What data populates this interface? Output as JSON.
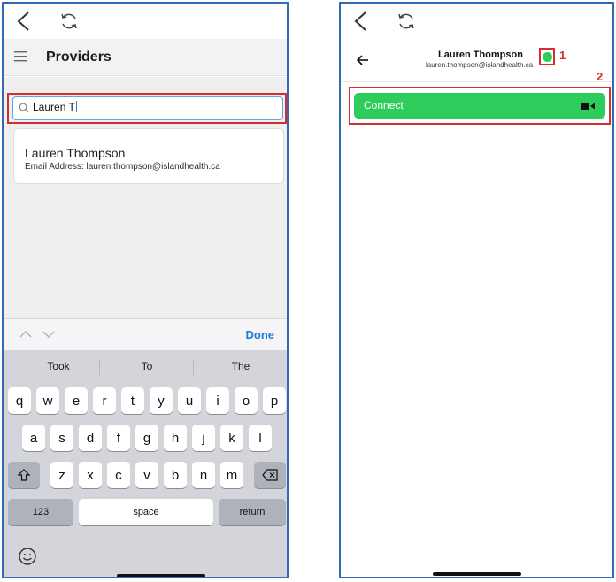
{
  "left_screen": {
    "providers_title": "Providers",
    "search_value": "Lauren T",
    "result": {
      "name": "Lauren Thompson",
      "email_line": "Email Address: lauren.thompson@islandhealth.ca"
    },
    "keyboard": {
      "done_label": "Done",
      "suggestions": [
        "Took",
        "To",
        "The"
      ],
      "row1": [
        "q",
        "w",
        "e",
        "r",
        "t",
        "y",
        "u",
        "i",
        "o",
        "p"
      ],
      "row2": [
        "a",
        "s",
        "d",
        "f",
        "g",
        "h",
        "j",
        "k",
        "l"
      ],
      "row3": [
        "z",
        "x",
        "c",
        "v",
        "b",
        "n",
        "m"
      ],
      "numbers_label": "123",
      "space_label": "space",
      "return_label": "return"
    }
  },
  "right_screen": {
    "name": "Lauren Thompson",
    "email": "lauren.thompson@islandhealth.ca",
    "status_color": "#2ecc5a",
    "connect_label": "Connect",
    "callout_1": "1",
    "callout_2": "2"
  },
  "colors": {
    "accent_blue": "#1e78e0",
    "frame_blue": "#2e6db3",
    "annotation_red": "#d32f2f",
    "connect_green": "#2ecc5a"
  },
  "icons": [
    "back-chevron-icon",
    "refresh-icon",
    "hamburger-icon",
    "search-icon",
    "chevron-up-icon",
    "chevron-down-icon",
    "shift-icon",
    "backspace-icon",
    "emoji-icon",
    "back-arrow-icon",
    "video-camera-icon"
  ]
}
